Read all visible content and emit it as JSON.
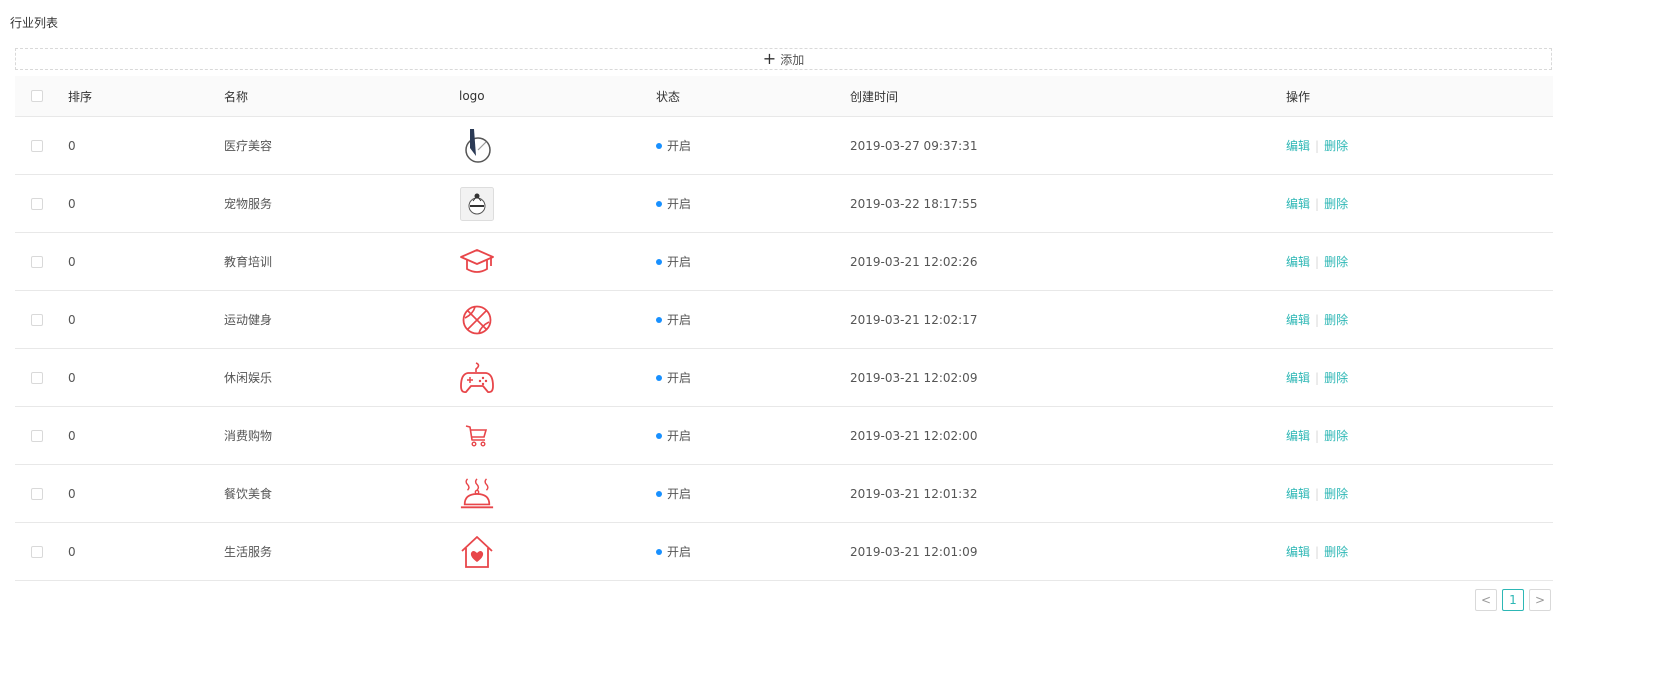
{
  "page_title": "行业列表",
  "add_button": {
    "label": "添加"
  },
  "columns": {
    "sort": "排序",
    "name": "名称",
    "logo": "logo",
    "status": "状态",
    "created": "创建时间",
    "ops": "操作"
  },
  "rows": [
    {
      "sort": "0",
      "name": "医疗美容",
      "logo": "medical-beauty-icon",
      "status": "开启",
      "created": "2019-03-27 09:37:31",
      "edit": "编辑",
      "delete": "删除"
    },
    {
      "sort": "0",
      "name": "宠物服务",
      "logo": "pet-service-icon",
      "status": "开启",
      "created": "2019-03-22 18:17:55",
      "edit": "编辑",
      "delete": "删除"
    },
    {
      "sort": "0",
      "name": "教育培训",
      "logo": "graduation-cap-icon",
      "status": "开启",
      "created": "2019-03-21 12:02:26",
      "edit": "编辑",
      "delete": "删除"
    },
    {
      "sort": "0",
      "name": "运动健身",
      "logo": "basketball-icon",
      "status": "开启",
      "created": "2019-03-21 12:02:17",
      "edit": "编辑",
      "delete": "删除"
    },
    {
      "sort": "0",
      "name": "休闲娱乐",
      "logo": "gamepad-icon",
      "status": "开启",
      "created": "2019-03-21 12:02:09",
      "edit": "编辑",
      "delete": "删除"
    },
    {
      "sort": "0",
      "name": "消费购物",
      "logo": "shopping-cart-icon",
      "status": "开启",
      "created": "2019-03-21 12:02:00",
      "edit": "编辑",
      "delete": "删除"
    },
    {
      "sort": "0",
      "name": "餐饮美食",
      "logo": "food-cloche-icon",
      "status": "开启",
      "created": "2019-03-21 12:01:32",
      "edit": "编辑",
      "delete": "删除"
    },
    {
      "sort": "0",
      "name": "生活服务",
      "logo": "home-heart-icon",
      "status": "开启",
      "created": "2019-03-21 12:01:09",
      "edit": "编辑",
      "delete": "删除"
    }
  ],
  "pagination": {
    "prev": "<",
    "current": "1",
    "next": ">"
  },
  "colors": {
    "accent": "#2db7b5",
    "status_dot": "#1890ff",
    "icon_red": "#e8464a"
  }
}
